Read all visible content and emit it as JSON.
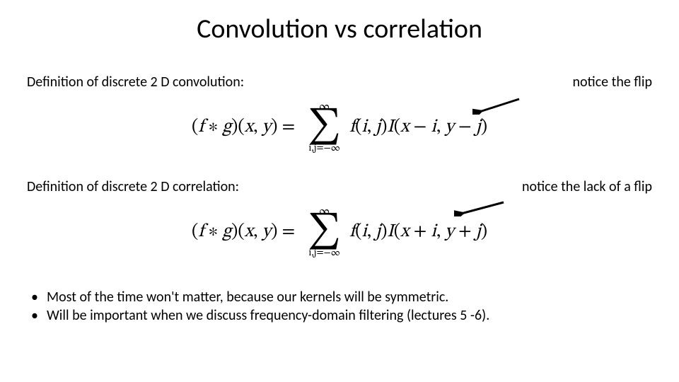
{
  "title": "Convolution vs correlation",
  "section1": {
    "label": "Definition of discrete 2 D convolution:",
    "note": "notice the flip",
    "equation": {
      "lhs_open": "(",
      "lhs_f": "f",
      "lhs_star": " ∗ ",
      "lhs_g": "g",
      "lhs_close": ")(",
      "lhs_x": "x",
      "lhs_comma1": ", ",
      "lhs_y": "y",
      "lhs_end": ") = ",
      "sum_top": "∞",
      "sum_bot": "i,j=−∞",
      "rhs_f": "f",
      "rhs_open1": "(",
      "rhs_i": "i",
      "rhs_c1": ", ",
      "rhs_j": "j",
      "rhs_close1": ")",
      "rhs_I": "I",
      "rhs_open2": "(",
      "rhs_x": "x",
      "rhs_op1": " − ",
      "rhs_i2": "i",
      "rhs_c2": ", ",
      "rhs_y": "y",
      "rhs_op2": " − ",
      "rhs_j2": "j",
      "rhs_close2": ")"
    }
  },
  "section2": {
    "label": "Definition of discrete 2 D correlation:",
    "note": "notice the lack of a flip",
    "equation": {
      "lhs_open": "(",
      "lhs_f": "f",
      "lhs_star": " ∗ ",
      "lhs_g": "g",
      "lhs_close": ")(",
      "lhs_x": "x",
      "lhs_comma1": ", ",
      "lhs_y": "y",
      "lhs_end": ") = ",
      "sum_top": "∞",
      "sum_bot": "i,j=−∞",
      "rhs_f": "f",
      "rhs_open1": "(",
      "rhs_i": "i",
      "rhs_c1": ", ",
      "rhs_j": "j",
      "rhs_close1": ")",
      "rhs_I": "I",
      "rhs_open2": "(",
      "rhs_x": "x",
      "rhs_op1": " + ",
      "rhs_i2": "i",
      "rhs_c2": ", ",
      "rhs_y": "y",
      "rhs_op2": " + ",
      "rhs_j2": "j",
      "rhs_close2": ")"
    }
  },
  "bullets": {
    "b1": "Most of the time won't matter, because our kernels will be symmetric.",
    "b2": " Will be important when we discuss frequency-domain filtering (lectures 5 -6)."
  },
  "glyphs": {
    "bullet": "•"
  }
}
